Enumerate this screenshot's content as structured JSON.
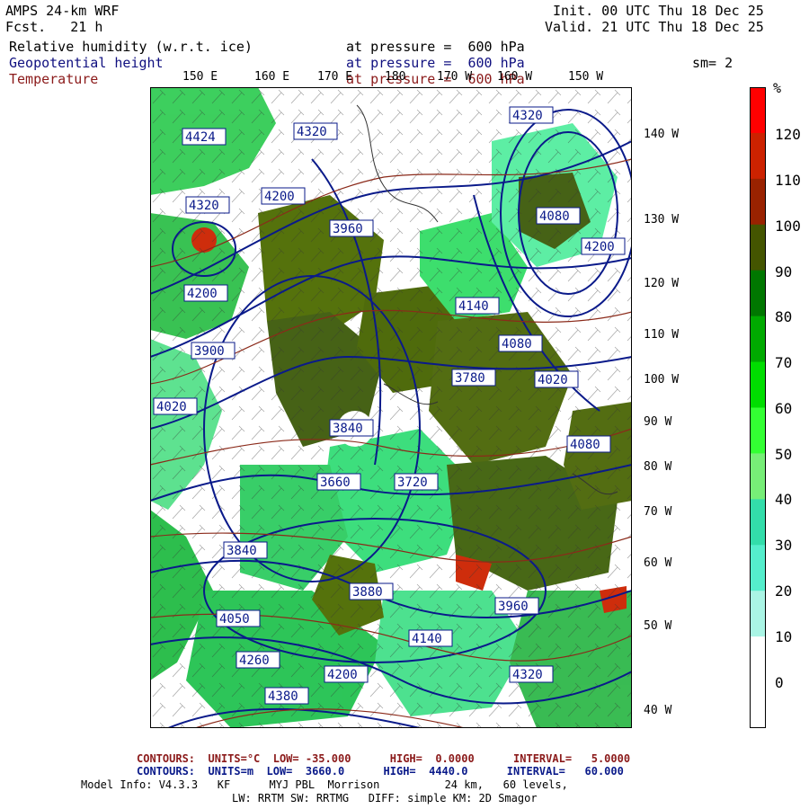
{
  "header": {
    "model": "AMPS 24-km WRF",
    "fcst": "Fcst.   21 h",
    "init": "Init. 00 UTC Thu 18 Dec 25",
    "valid": "Valid. 21 UTC Thu 18 Dec 25"
  },
  "fields": {
    "rh": {
      "name": "Relative humidity (w.r.t. ice)",
      "level": "at pressure =  600 hPa"
    },
    "hgt": {
      "name": "Geopotential height",
      "level": "at pressure =  600 hPa"
    },
    "temp": {
      "name": "Temperature",
      "level": "at pressure =  600 hPa"
    },
    "smooth": "sm= 2"
  },
  "longitude_labels_top": [
    "150 E",
    "160 E",
    "170 E",
    "180",
    "170 W",
    "160 W",
    "150 W"
  ],
  "longitude_labels_right": [
    "140 W",
    "130 W",
    "120 W",
    "110 W",
    "100 W",
    "90 W",
    "80 W",
    "70 W",
    "60 W",
    "50 W",
    "40 W"
  ],
  "colorbar": {
    "unit": "%",
    "ticks": [
      "120",
      "110",
      "100",
      "90",
      "80",
      "70",
      "60",
      "50",
      "40",
      "30",
      "20",
      "10",
      "0"
    ],
    "colors": [
      "#ff0000",
      "#cc2200",
      "#992200",
      "#445500",
      "#007700",
      "#00aa00",
      "#00dd00",
      "#33ff33",
      "#77ee77",
      "#33ddaa",
      "#55eecc",
      "#aaf5e5",
      "#ffffff",
      "#ffffff"
    ]
  },
  "height_contour_labels": [
    {
      "text": "4320"
    },
    {
      "text": "4320"
    },
    {
      "text": "4200"
    },
    {
      "text": "4320"
    },
    {
      "text": "4424"
    },
    {
      "text": "4200"
    },
    {
      "text": "4080"
    },
    {
      "text": "3960"
    },
    {
      "text": "4200"
    },
    {
      "text": "4140"
    },
    {
      "text": "4080"
    },
    {
      "text": "4020"
    },
    {
      "text": "3900"
    },
    {
      "text": "3840"
    },
    {
      "text": "3780"
    },
    {
      "text": "3660"
    },
    {
      "text": "4020"
    },
    {
      "text": "3840"
    },
    {
      "text": "3720"
    },
    {
      "text": "4200"
    },
    {
      "text": "4380"
    },
    {
      "text": "4260"
    },
    {
      "text": "4320"
    },
    {
      "text": "3960"
    },
    {
      "text": "4050"
    },
    {
      "text": "3880"
    },
    {
      "text": "4080"
    },
    {
      "text": "4140"
    }
  ],
  "footer": {
    "temp_contours": "CONTOURS:  UNITS=°C  LOW= -35.000      HIGH=  0.0000      INTERVAL=   5.0000",
    "hgt_contours": "CONTOURS:  UNITS=m  LOW=  3660.0      HIGH=  4440.0      INTERVAL=   60.000",
    "model_info": "Model Info: V4.3.3   KF      MYJ PBL  Morrison          24 km,   60 levels,",
    "physics": "LW: RRTM SW: RRTMG   DIFF: simple KM: 2D Smagor"
  }
}
